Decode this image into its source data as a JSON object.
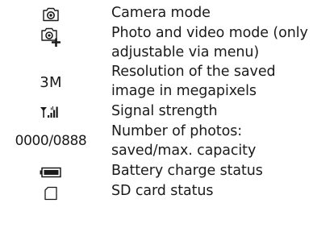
{
  "legend": {
    "rows": [
      {
        "icon": "camera-icon",
        "desc": [
          "Camera mode"
        ]
      },
      {
        "icon": "photo-video-icon",
        "desc": [
          "Photo and video mode (only",
          "adjustable via menu)"
        ]
      },
      {
        "symbol": "3M",
        "desc": [
          "Resolution of the saved",
          "image in megapixels"
        ]
      },
      {
        "icon": "signal-strength-icon",
        "desc": [
          "Signal strength"
        ]
      },
      {
        "symbol": "0000/0888",
        "desc": [
          "Number of photos:",
          "saved/max. capacity"
        ]
      },
      {
        "icon": "battery-icon",
        "desc": [
          "Battery charge status"
        ]
      },
      {
        "icon": "sd-card-icon",
        "desc": [
          "SD card status"
        ]
      }
    ]
  }
}
